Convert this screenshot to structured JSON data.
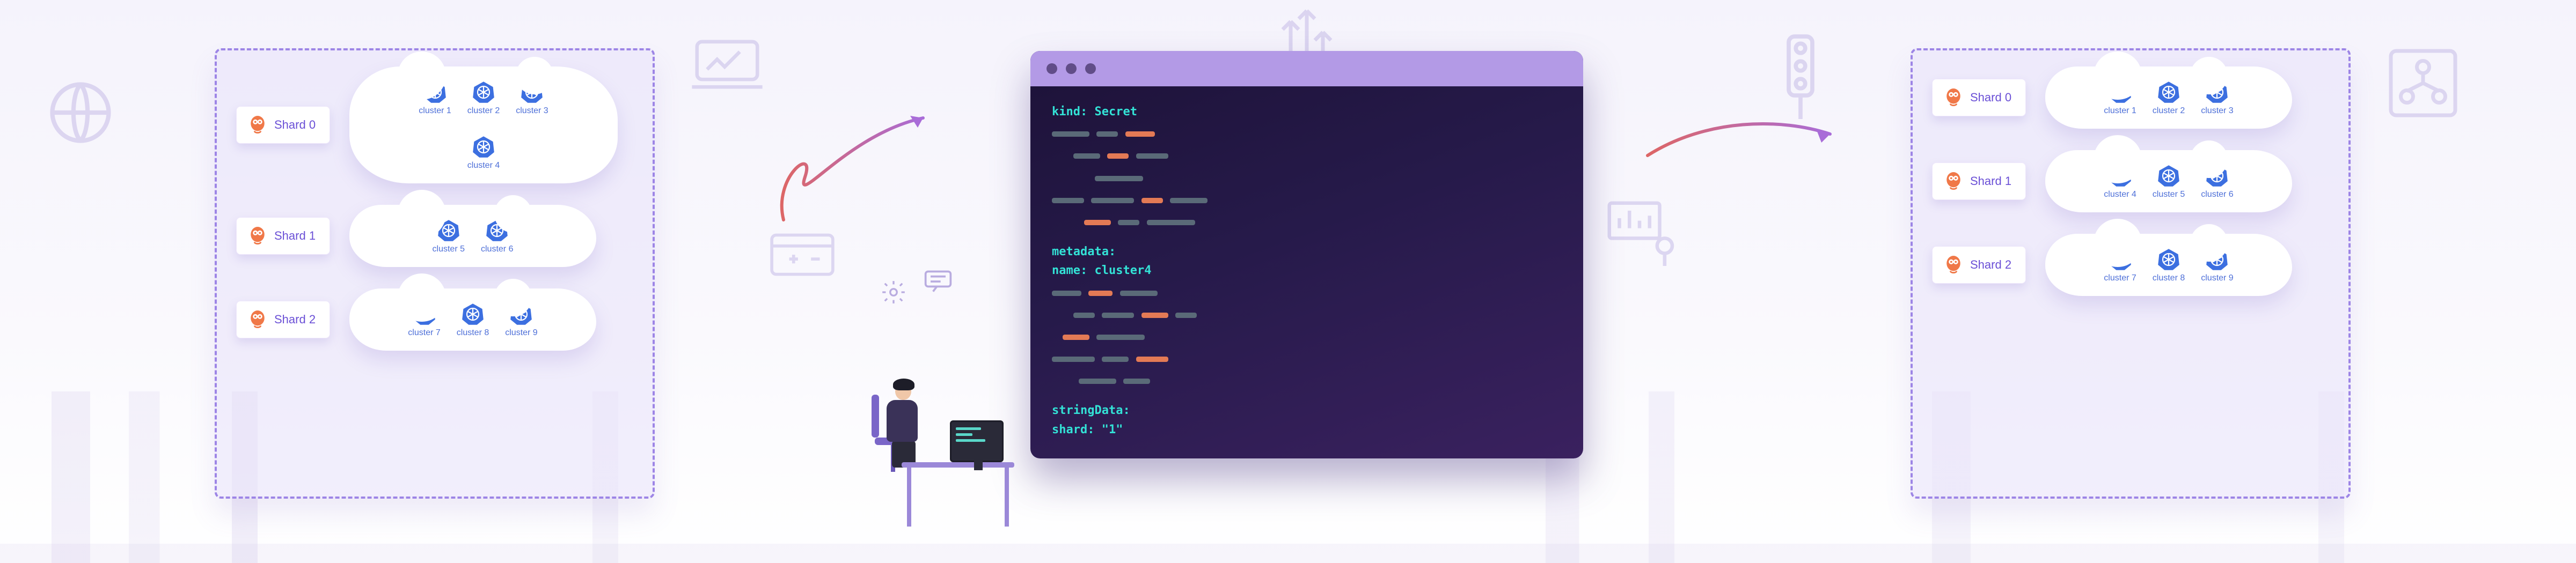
{
  "code": {
    "line1_key": "kind:",
    "line1_val": " Secret",
    "metadata_key": "metadata:",
    "name_key": "  name:",
    "name_val": " cluster4",
    "stringdata_key": "stringData:",
    "shard_key": "  shard:",
    "shard_val": " \"1\""
  },
  "left_panel": {
    "shards": [
      {
        "label": "Shard 0",
        "clusters": [
          "cluster 1",
          "cluster 2",
          "cluster 3",
          "cluster 4"
        ]
      },
      {
        "label": "Shard 1",
        "clusters": [
          "cluster 5",
          "cluster 6"
        ]
      },
      {
        "label": "Shard 2",
        "clusters": [
          "cluster 7",
          "cluster 8",
          "cluster 9"
        ]
      }
    ]
  },
  "right_panel": {
    "shards": [
      {
        "label": "Shard 0",
        "clusters": [
          "cluster 1",
          "cluster 2",
          "cluster 3"
        ]
      },
      {
        "label": "Shard 1",
        "clusters": [
          "cluster 4",
          "cluster 5",
          "cluster 6"
        ]
      },
      {
        "label": "Shard 2",
        "clusters": [
          "cluster 7",
          "cluster 8",
          "cluster 9"
        ]
      }
    ]
  }
}
